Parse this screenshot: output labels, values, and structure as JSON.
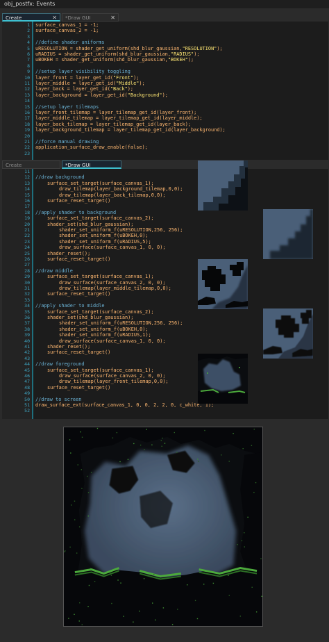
{
  "window": {
    "title": "obj_postfx: Events"
  },
  "tabs_top": [
    {
      "label": "Create",
      "active": true
    },
    {
      "label": "*Draw GUI",
      "active": false
    }
  ],
  "close_glyph": "✕",
  "create_lines": [
    {
      "n": "1",
      "text": "surface_canvas_1 = -1;",
      "kind": "code"
    },
    {
      "n": "2",
      "text": "surface_canvas_2 = -1;",
      "kind": "code"
    },
    {
      "n": "3",
      "text": "",
      "kind": "code"
    },
    {
      "n": "4",
      "text": "//define shader uniforms",
      "kind": "comment"
    },
    {
      "n": "5",
      "text": "uRESOLUTION = shader_get_uniform(shd_blur_gaussian,\"RESOLUTION\");",
      "kind": "code"
    },
    {
      "n": "6",
      "text": "uRADIUS = shader_get_uniform(shd_blur_gaussian,\"RADIUS\");",
      "kind": "code"
    },
    {
      "n": "7",
      "text": "uBOKEH = shader_get_uniform(shd_blur_gaussian,\"BOKEH\");",
      "kind": "code"
    },
    {
      "n": "8",
      "text": "",
      "kind": "code"
    },
    {
      "n": "9",
      "text": "//setup layer visibility toggling",
      "kind": "comment"
    },
    {
      "n": "10",
      "text": "layer_front = layer_get_id(\"Front\");",
      "kind": "code"
    },
    {
      "n": "11",
      "text": "layer_middle = layer_get_id(\"Middle\");",
      "kind": "code"
    },
    {
      "n": "12",
      "text": "layer_back = layer_get_id(\"Back\");",
      "kind": "code"
    },
    {
      "n": "13",
      "text": "layer_background = layer_get_id(\"Background\");",
      "kind": "code"
    },
    {
      "n": "14",
      "text": "",
      "kind": "code"
    },
    {
      "n": "15",
      "text": "//setup layer tilemaps",
      "kind": "comment"
    },
    {
      "n": "16",
      "text": "layer_front_tilemap = layer_tilemap_get_id(layer_front);",
      "kind": "code"
    },
    {
      "n": "17",
      "text": "layer_middle_tilemap = layer_tilemap_get_id(layer_middle);",
      "kind": "code"
    },
    {
      "n": "18",
      "text": "layer_back_tilemap = layer_tilemap_get_id(layer_back);",
      "kind": "code"
    },
    {
      "n": "19",
      "text": "layer_background_tilemap = layer_tilemap_get_id(layer_background);",
      "kind": "code"
    },
    {
      "n": "20",
      "text": "",
      "kind": "code"
    },
    {
      "n": "21",
      "text": "//force manual drawing",
      "kind": "comment"
    },
    {
      "n": "22",
      "text": "application_surface_draw_enable(false);",
      "kind": "code"
    },
    {
      "n": "23",
      "text": "",
      "kind": "code"
    }
  ],
  "tabs_bottom": [
    {
      "label": "Create",
      "active": false
    },
    {
      "label": "*Draw GUI",
      "active": true
    }
  ],
  "draw_lines": [
    {
      "n": "11",
      "text": "",
      "kind": "code",
      "indent": 0
    },
    {
      "n": "12",
      "text": "//draw background",
      "kind": "comment",
      "indent": 0
    },
    {
      "n": "13",
      "text": "surface_set_target(surface_canvas_1);",
      "kind": "code",
      "indent": 1
    },
    {
      "n": "14",
      "text": "draw_tilemap(layer_background_tilemap,0,0);",
      "kind": "code",
      "indent": 2
    },
    {
      "n": "15",
      "text": "draw_tilemap(layer_back_tilemap,0,0);",
      "kind": "code",
      "indent": 2
    },
    {
      "n": "16",
      "text": "surface_reset_target()",
      "kind": "code",
      "indent": 1
    },
    {
      "n": "17",
      "text": "",
      "kind": "code",
      "indent": 0
    },
    {
      "n": "18",
      "text": "//apply shader to background",
      "kind": "comment",
      "indent": 0
    },
    {
      "n": "19",
      "text": "surface_set_target(surface_canvas_2);",
      "kind": "code",
      "indent": 1
    },
    {
      "n": "20",
      "text": "shader_set(shd_blur_gaussian);",
      "kind": "code",
      "indent": 1
    },
    {
      "n": "21",
      "text": "shader_set_uniform_f(uRESOLUTION,256, 256);",
      "kind": "code",
      "indent": 2
    },
    {
      "n": "22",
      "text": "shader_set_uniform_f(uBOKEH,0);",
      "kind": "code",
      "indent": 2
    },
    {
      "n": "23",
      "text": "shader_set_uniform_f(uRADIUS,5);",
      "kind": "code",
      "indent": 2
    },
    {
      "n": "24",
      "text": "draw_surface(surface_canvas_1, 0, 0);",
      "kind": "code",
      "indent": 2
    },
    {
      "n": "25",
      "text": "shader_reset();",
      "kind": "code",
      "indent": 1
    },
    {
      "n": "26",
      "text": "surface_reset_target()",
      "kind": "code",
      "indent": 1
    },
    {
      "n": "27",
      "text": "",
      "kind": "code",
      "indent": 0
    },
    {
      "n": "28",
      "text": "//draw middle",
      "kind": "comment",
      "indent": 0
    },
    {
      "n": "29",
      "text": "surface_set_target(surface_canvas_1);",
      "kind": "code",
      "indent": 1
    },
    {
      "n": "30",
      "text": "draw_surface(surface_canvas_2, 0, 0);",
      "kind": "code",
      "indent": 2
    },
    {
      "n": "31",
      "text": "draw_tilemap(layer_middle_tilemap,0,0);",
      "kind": "code",
      "indent": 2
    },
    {
      "n": "32",
      "text": "surface_reset_target()",
      "kind": "code",
      "indent": 1
    },
    {
      "n": "33",
      "text": "",
      "kind": "code",
      "indent": 0
    },
    {
      "n": "34",
      "text": "//apply shader to middle",
      "kind": "comment",
      "indent": 0
    },
    {
      "n": "35",
      "text": "surface_set_target(surface_canvas_2);",
      "kind": "code",
      "indent": 1
    },
    {
      "n": "36",
      "text": "shader_set(shd_blur_gaussian);",
      "kind": "code",
      "indent": 1
    },
    {
      "n": "37",
      "text": "shader_set_uniform_f(uRESOLUTION,256, 256);",
      "kind": "code",
      "indent": 2
    },
    {
      "n": "38",
      "text": "shader_set_uniform_f(uBOKEH,0);",
      "kind": "code",
      "indent": 2
    },
    {
      "n": "39",
      "text": "shader_set_uniform_f(uRADIUS,1);",
      "kind": "code",
      "indent": 2
    },
    {
      "n": "40",
      "text": "draw_surface(surface_canvas_1, 0, 0);",
      "kind": "code",
      "indent": 2
    },
    {
      "n": "41",
      "text": "shader_reset();",
      "kind": "code",
      "indent": 1
    },
    {
      "n": "42",
      "text": "surface_reset_target()",
      "kind": "code",
      "indent": 1
    },
    {
      "n": "43",
      "text": "",
      "kind": "code",
      "indent": 0
    },
    {
      "n": "44",
      "text": "//draw foreground",
      "kind": "comment",
      "indent": 0
    },
    {
      "n": "45",
      "text": "surface_set_target(surface_canvas_1);",
      "kind": "code",
      "indent": 1
    },
    {
      "n": "46",
      "text": "draw_surface(surface_canvas_2, 0, 0);",
      "kind": "code",
      "indent": 2
    },
    {
      "n": "47",
      "text": "draw_tilemap(layer_front_tilemap,0,0);",
      "kind": "code",
      "indent": 2
    },
    {
      "n": "48",
      "text": "surface_reset_target()",
      "kind": "code",
      "indent": 1
    },
    {
      "n": "49",
      "text": "",
      "kind": "code",
      "indent": 0
    },
    {
      "n": "50",
      "text": "//draw to screen",
      "kind": "comment",
      "indent": 0
    },
    {
      "n": "51",
      "text": "draw_surface_ext(surface_canvas_1, 0, 0, 2, 2, 0, c_white, 1);",
      "kind": "code",
      "indent": 0
    },
    {
      "n": "52",
      "text": "",
      "kind": "code",
      "indent": 0
    }
  ],
  "colors": {
    "editor_bg": "#1c1c1c",
    "code": "#ffb871",
    "comment": "#6bb3d6",
    "string": "#ffe773",
    "line_number": "#3fa7c4",
    "tab_accent": "#3ec0d0",
    "sky": "#4a5f78",
    "rock": "#0a0b0d",
    "moss": "#4caa3c"
  },
  "icons": [
    "close-icon",
    "preview-thumbnail"
  ]
}
